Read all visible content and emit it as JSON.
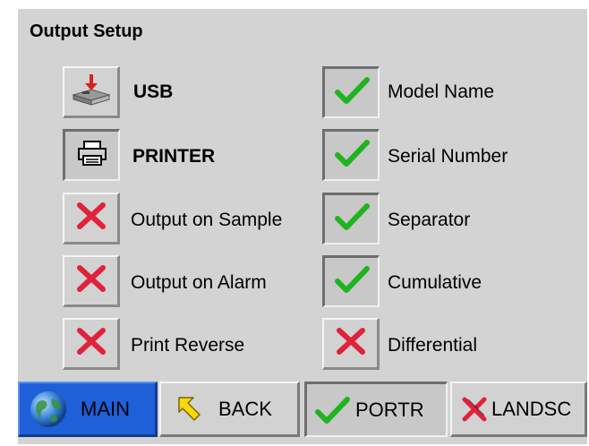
{
  "title": "Output Setup",
  "left_options": [
    {
      "label": "USB",
      "icon": "usb-drive-icon",
      "state": "raised"
    },
    {
      "label": "PRINTER",
      "icon": "printer-icon",
      "state": "pressed"
    },
    {
      "label": "Output on Sample",
      "icon": "red-x-icon",
      "state": "off"
    },
    {
      "label": "Output on Alarm",
      "icon": "red-x-icon",
      "state": "off"
    },
    {
      "label": "Print Reverse",
      "icon": "red-x-icon",
      "state": "off"
    }
  ],
  "right_options": [
    {
      "label": "Model Name",
      "icon": "green-check-icon",
      "state": "on"
    },
    {
      "label": "Serial Number",
      "icon": "green-check-icon",
      "state": "on"
    },
    {
      "label": "Separator",
      "icon": "green-check-icon",
      "state": "on"
    },
    {
      "label": "Cumulative",
      "icon": "green-check-icon",
      "state": "on"
    },
    {
      "label": "Differential",
      "icon": "red-x-icon",
      "state": "off"
    }
  ],
  "nav": {
    "main": "MAIN",
    "back": "BACK",
    "portr": "PORTR",
    "landsc": "LANDSC"
  },
  "colors": {
    "panel": "#d3d3d3",
    "check": "#1fb41f",
    "cross": "#e0223a",
    "main_button": "#1f5fd8"
  }
}
